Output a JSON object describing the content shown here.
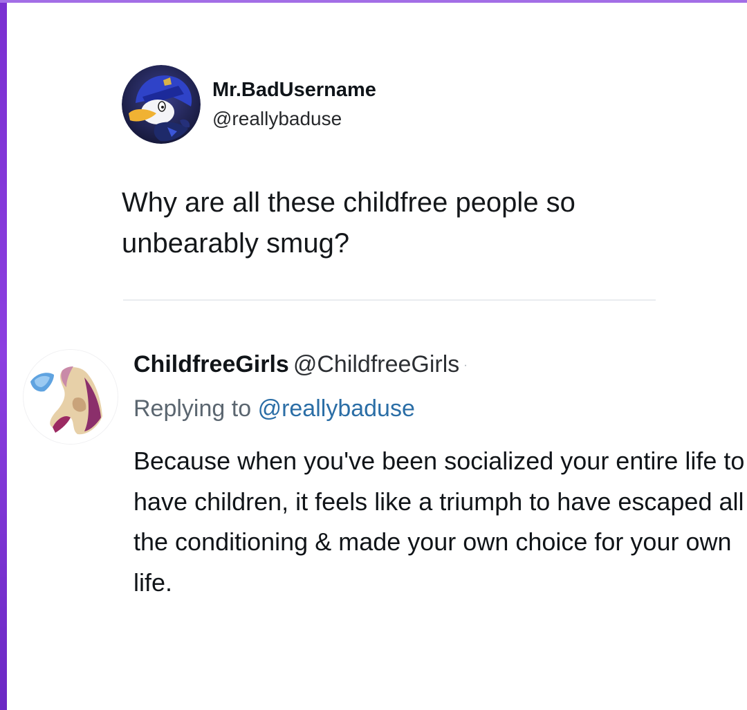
{
  "tweet": {
    "display_name": "Mr.BadUsername",
    "handle": "@reallybaduse",
    "avatar_icon": "donald-duck-avatar-icon",
    "text": "Why are all these childfree people so unbearably smug?"
  },
  "reply": {
    "display_name": "ChildfreeGirls",
    "handle": "@ChildfreeGirls",
    "separator": "·",
    "avatar_icon": "childfree-girls-avatar-icon",
    "replying_label": "Replying to",
    "replying_to": "@reallybaduse",
    "text": "Because when you've been socialized your entire life to have children, it feels like a triumph to have escaped all the conditioning & made your own choice for your own life."
  },
  "colors": {
    "accent_link": "#2b6ea6",
    "frame_purple": "#7a2fd1"
  }
}
